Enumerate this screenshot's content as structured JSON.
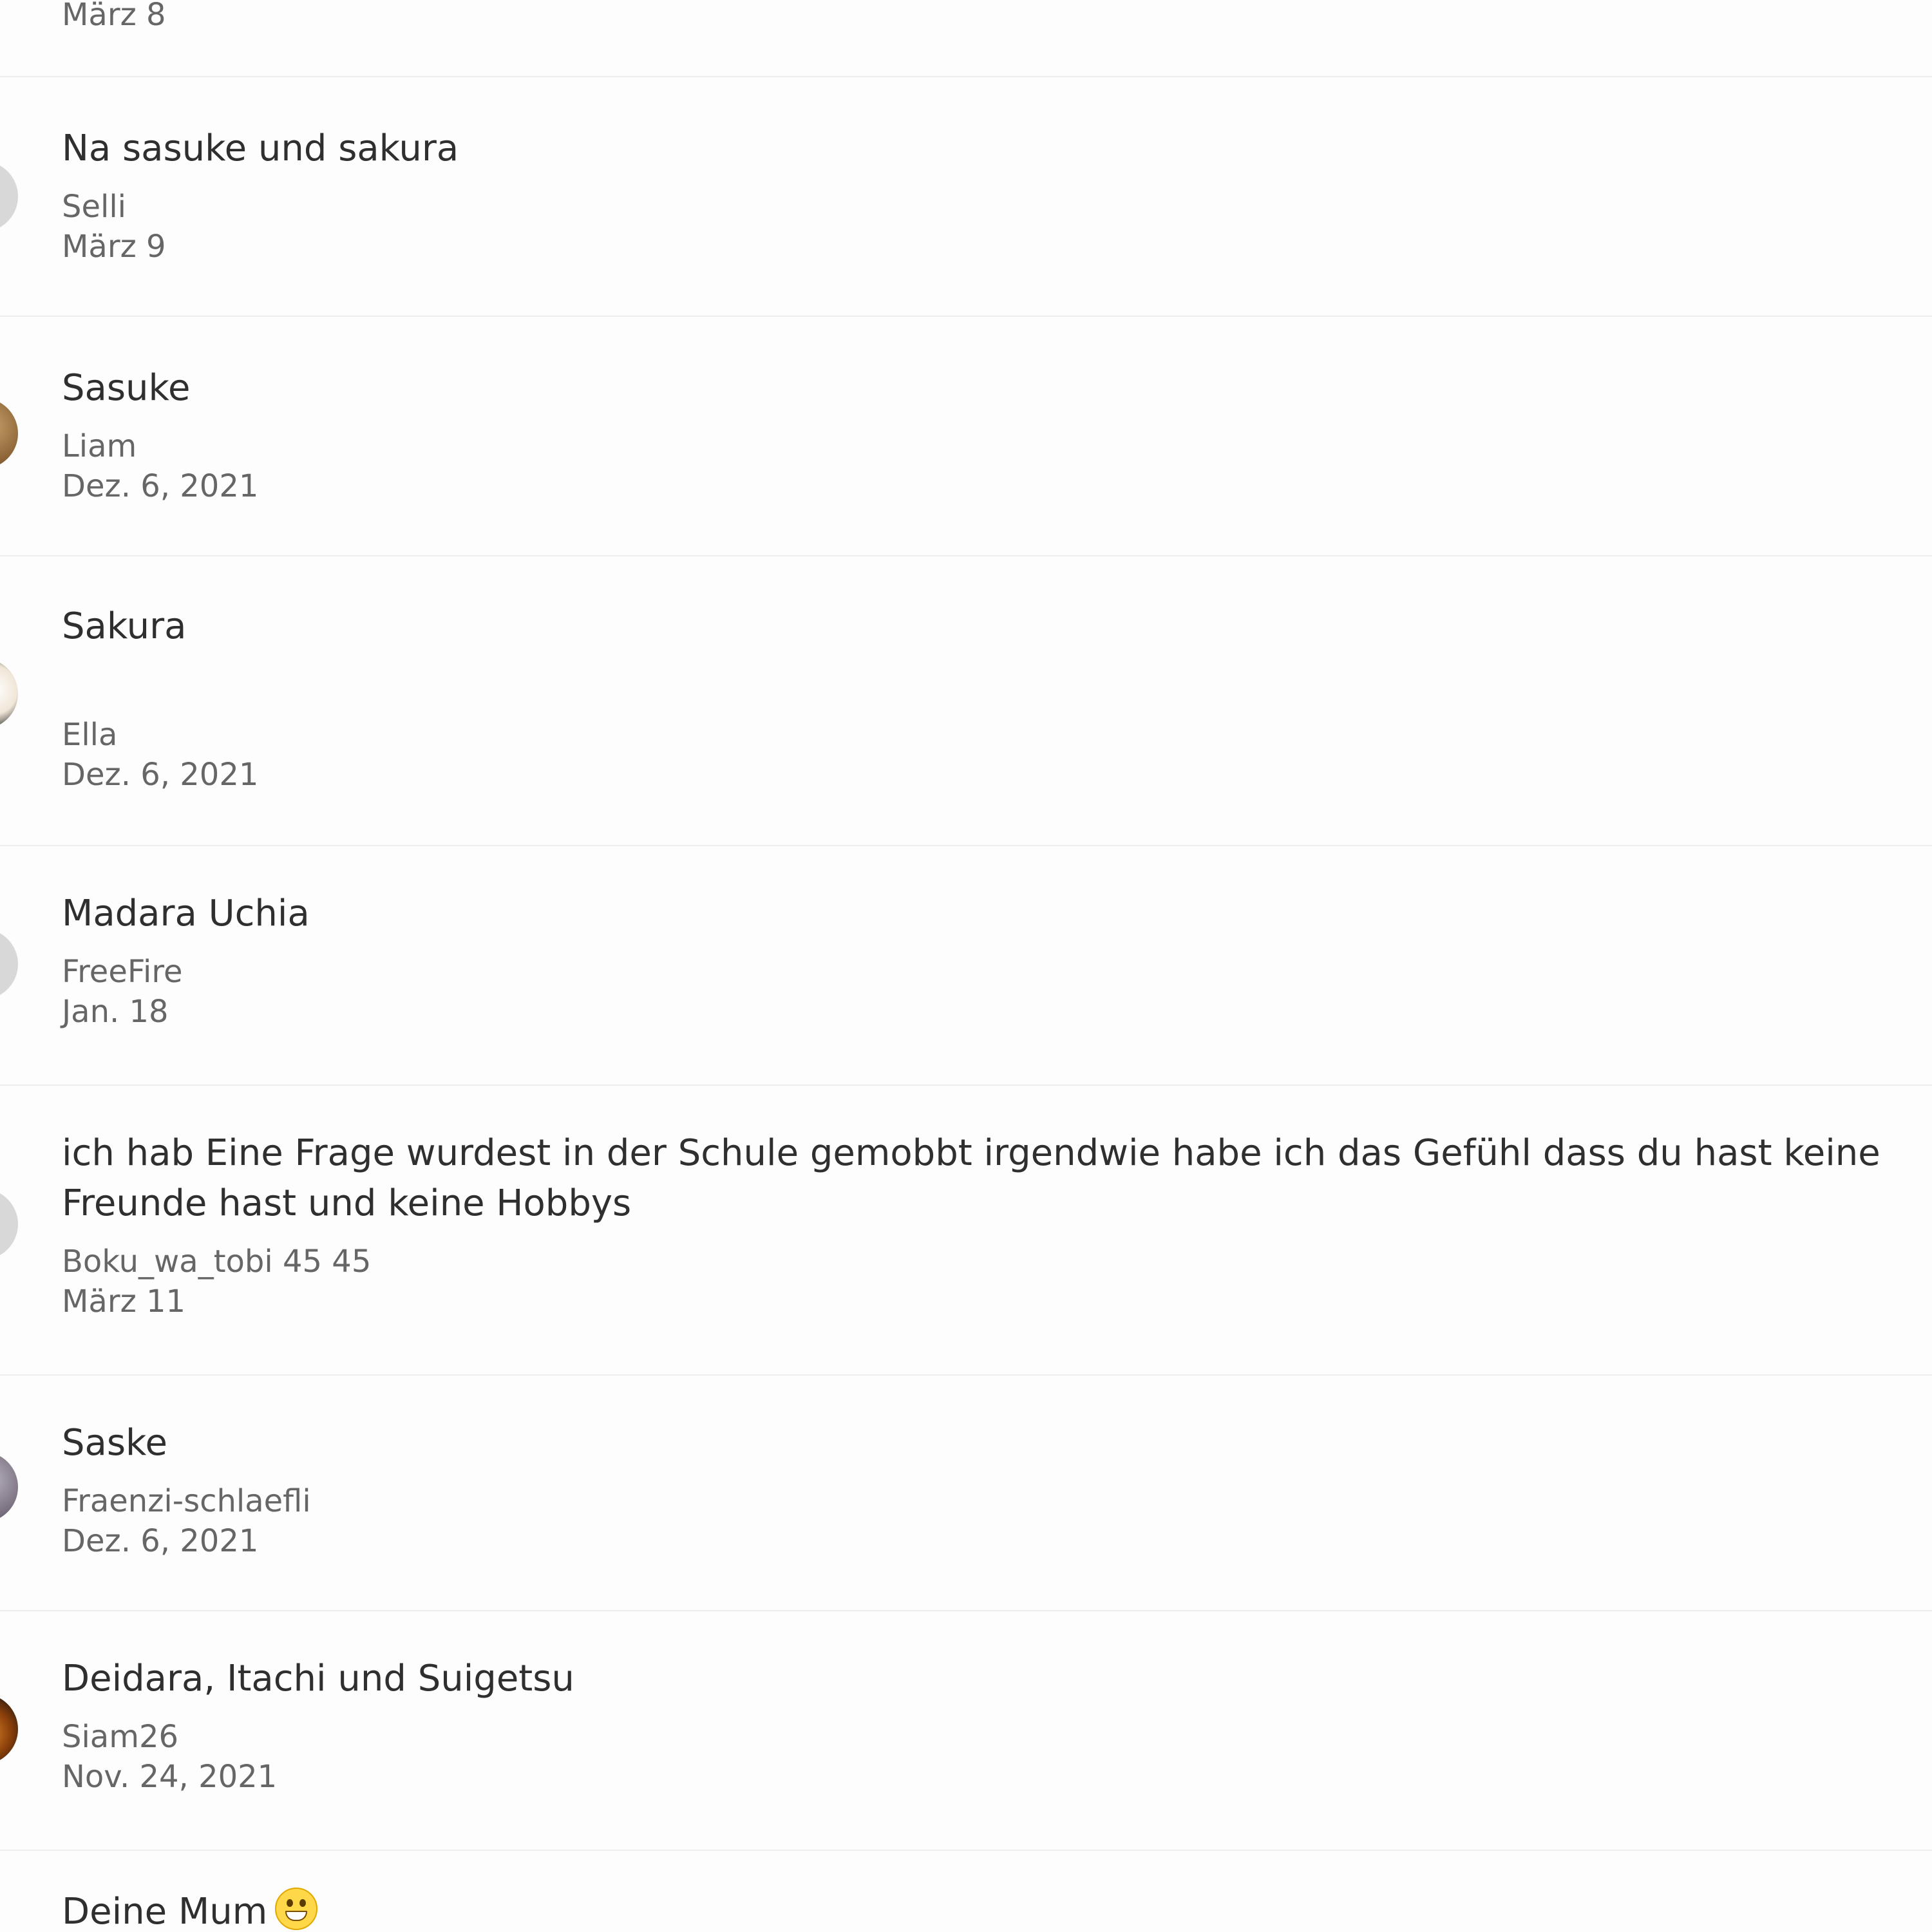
{
  "items": [
    {
      "title": "",
      "author": "",
      "date": "März 8"
    },
    {
      "title": "Na sasuke und sakura",
      "author": "Selli",
      "date": "März 9"
    },
    {
      "title": "Sasuke",
      "author": "Liam",
      "date": "Dez. 6, 2021"
    },
    {
      "title": "Sakura",
      "author": "Ella",
      "date": "Dez. 6, 2021"
    },
    {
      "title": "Madara Uchia",
      "author": "FreeFire",
      "date": "Jan. 18"
    },
    {
      "title": "ich hab Eine Frage  wurdest in der Schule gemobbt irgendwie habe ich das Gefühl dass du hast keine Freunde hast und keine Hobbys",
      "author": "Boku_wa_tobi 45 45",
      "date": "März 11"
    },
    {
      "title": "Saske",
      "author": "Fraenzi-schlaefli",
      "date": "Dez. 6, 2021"
    },
    {
      "title": "Deidara, Itachi und Suigetsu",
      "author": "Siam26",
      "date": "Nov. 24, 2021"
    },
    {
      "title": "Deine Mum",
      "author": "",
      "date": "",
      "emoji": "grinning-face"
    }
  ],
  "colors": {
    "background": "#fdfdfd",
    "divider": "#eeeeee",
    "title_text": "#2f2f2f",
    "meta_text": "#666666"
  }
}
